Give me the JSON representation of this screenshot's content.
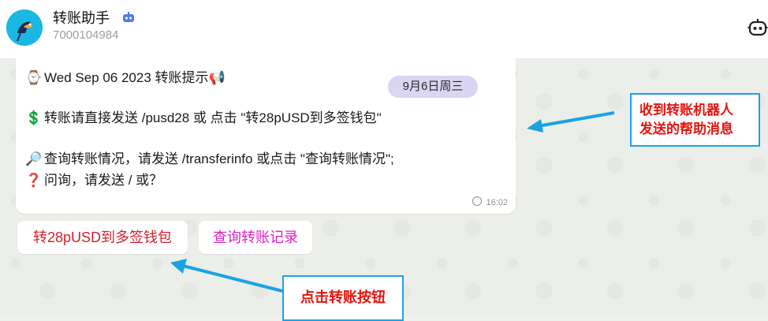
{
  "header": {
    "title": "转账助手",
    "subtitle": "7000104984",
    "badge_icon": "bot-badge-icon",
    "right_icon": "bot-icon"
  },
  "message": {
    "lines": [
      {
        "icon": "watch-icon",
        "glyph": "⌚",
        "text": "Wed Sep 06 2023 转账提示",
        "trail_glyph": "📢"
      },
      {
        "icon": "dollar-icon",
        "glyph": "💲",
        "text": "转账请直接发送 /pusd28 或 点击 \"转28pUSD到多签钱包\""
      },
      {
        "icon": "magnifier-icon",
        "glyph": "🔎",
        "text": "查询转账情况，请发送 /transferinfo 或点击 \"查询转账情况\";"
      },
      {
        "icon": "question-icon",
        "glyph": "❓",
        "text": "问询，请发送 / 或？"
      }
    ],
    "date_chip": "9月6日周三",
    "time": "16:02"
  },
  "buttons": {
    "transfer": "转28pUSD到多签钱包",
    "query": "查询转账记录"
  },
  "annotations": {
    "callout_1_line1": "收到转账机器人",
    "callout_1_line2": "发送的帮助消息",
    "callout_2": "点击转账按钮",
    "color_arrow": "#1aa3e4",
    "color_text": "#e2150f"
  }
}
